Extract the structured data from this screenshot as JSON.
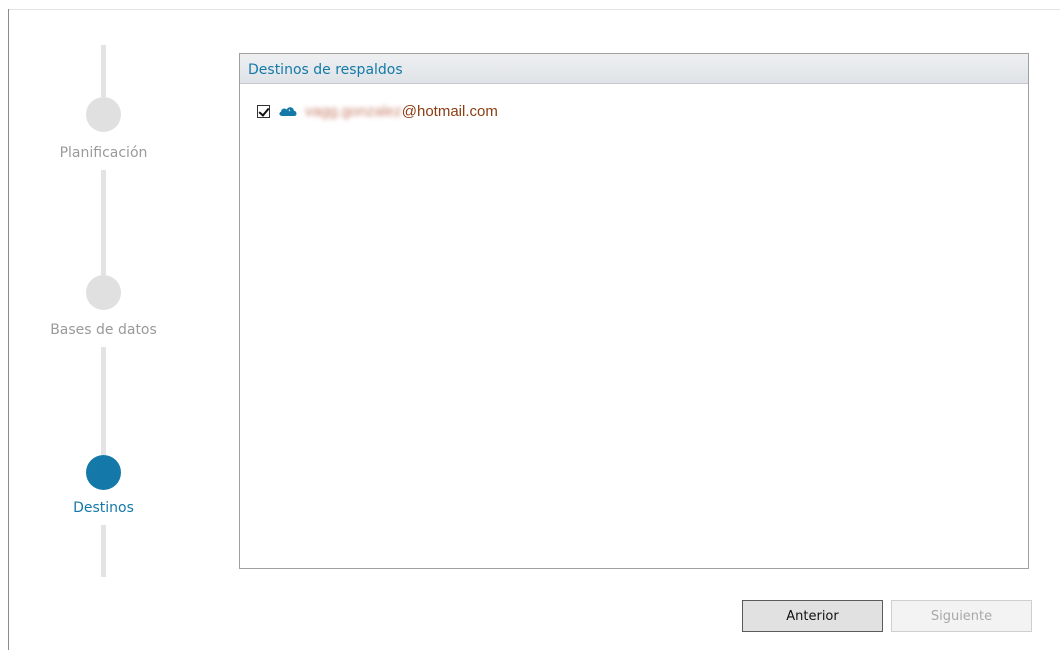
{
  "stepper": {
    "steps": [
      {
        "label": "Planificación",
        "active": false
      },
      {
        "label": "Bases de datos",
        "active": false
      },
      {
        "label": "Destinos",
        "active": true
      }
    ],
    "colors": {
      "active": "#1479a8",
      "inactive": "#e0e0e0"
    }
  },
  "panel": {
    "title": "Destinos de respaldos",
    "destinations": [
      {
        "checked": true,
        "icon": "onedrive-cloud-icon",
        "account_blurred": "vagg.gonzalez",
        "account_domain": "@hotmail.com"
      }
    ]
  },
  "buttons": {
    "previous_label": "Anterior",
    "next_label": "Siguiente"
  }
}
